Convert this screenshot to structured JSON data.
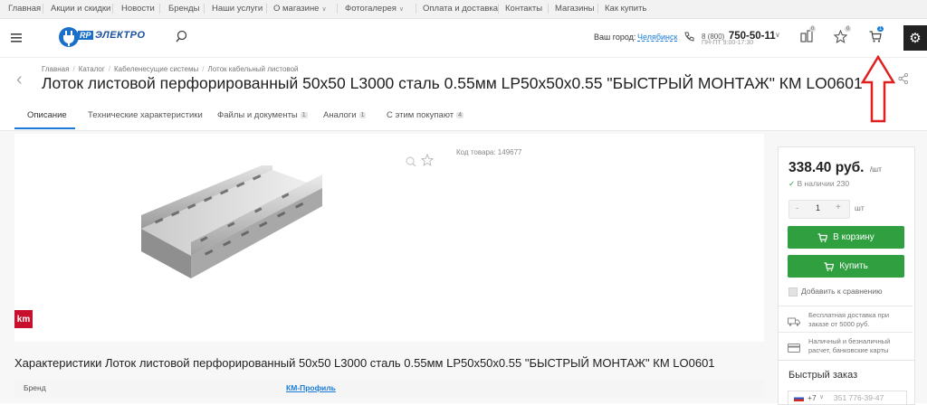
{
  "topnav": {
    "items": [
      {
        "label": "Главная"
      },
      {
        "label": "Акции и скидки"
      },
      {
        "label": "Новости"
      },
      {
        "label": "Бренды"
      },
      {
        "label": "Наши услуги"
      },
      {
        "label": "О магазине"
      },
      {
        "label": "Фотогалерея"
      },
      {
        "label": "Оплата и доставка"
      },
      {
        "label": "Контакты"
      },
      {
        "label": "Магазины"
      },
      {
        "label": "Как купить"
      }
    ]
  },
  "header": {
    "logo_text": "ЭЛЕКТРО",
    "logo_badge": "RP",
    "city_label": "Ваш город:",
    "city_value": "Челябинск",
    "phone_prefix": "8 (800)",
    "phone_number": "750-50-11",
    "phone_hours": "ПН-ПТ 9:00-17:30",
    "compare_count": "0",
    "favorites_count": "0",
    "cart_count": "1"
  },
  "breadcrumbs": [
    "Главная",
    "Каталог",
    "Кабеленесущие системы",
    "Лоток кабельный листовой"
  ],
  "product": {
    "title": "Лоток листовой перфорированный 50х50 L3000 сталь 0.55мм LP50x50x0.55 \"БЫСТРЫЙ МОНТАЖ\" КМ LO0601",
    "code_label": "Код товара: 149677",
    "brand_logo_text": "km"
  },
  "tabs": [
    {
      "label": "Описание",
      "count": ""
    },
    {
      "label": "Технические характеристики",
      "count": ""
    },
    {
      "label": "Файлы и документы",
      "count": "1"
    },
    {
      "label": "Аналоги",
      "count": "1"
    },
    {
      "label": "С этим покупают",
      "count": "4"
    }
  ],
  "price": {
    "value": "338.40 руб.",
    "unit": "/шт",
    "stock": "В наличии 230",
    "qty": "1",
    "qty_unit": "шт",
    "minus": "-",
    "plus": "+",
    "cart_button": "В корзину",
    "buy_button": "Купить",
    "compare_label": "Добавить к сравнению",
    "delivery_text": "Бесплатная доставка при заказе от 5000 руб.",
    "payment_text": "Наличный и безналичный расчет, банковские карты"
  },
  "quick_order": {
    "title": "Быстрый заказ",
    "phone_code": "+7",
    "phone_placeholder": "351 776-39-47"
  },
  "characteristics": {
    "title": "Характеристики Лоток листовой перфорированный 50х50 L3000 сталь 0.55мм LP50x50x0.55 \"БЫСТРЫЙ МОНТАЖ\" КМ LO0601",
    "rows": [
      {
        "name": "Бренд",
        "value": "КМ-Профиль"
      }
    ]
  },
  "colors": {
    "accent_blue": "#1a7bd6",
    "button_green": "#2f9f3f",
    "annotation_red": "#e02020"
  }
}
